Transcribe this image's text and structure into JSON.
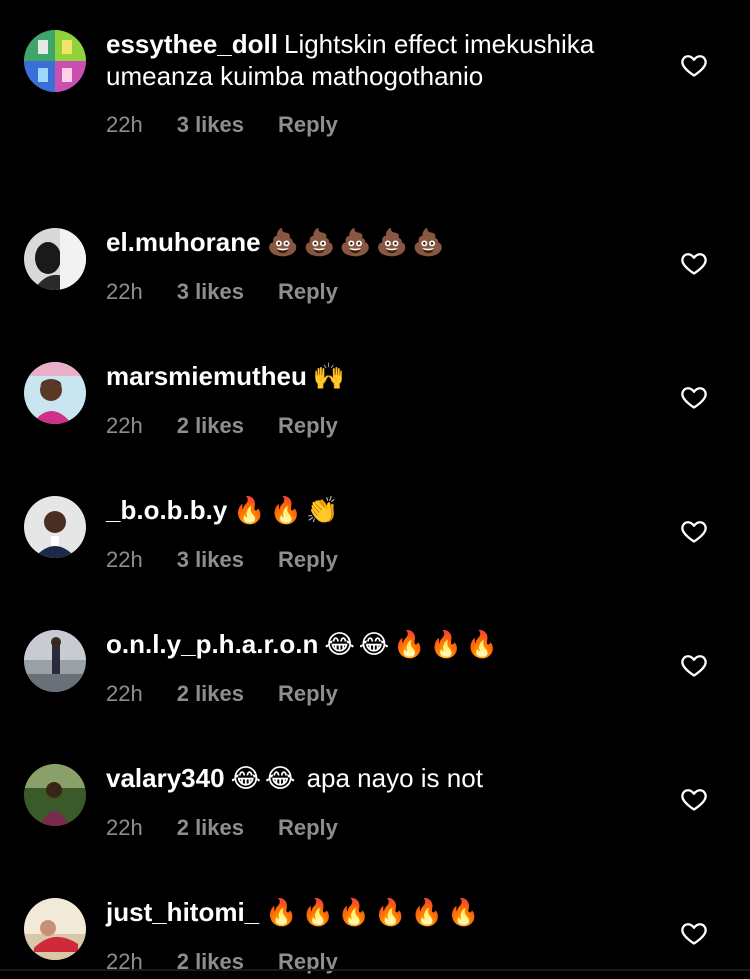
{
  "comments": [
    {
      "username": "essythee_doll",
      "text": "Lightskin effect imekushika umeanza kuimba mathogothanio",
      "emoji": "",
      "text_after": "",
      "time": "22h",
      "likes": "3 likes",
      "reply": "Reply"
    },
    {
      "username": "el.muhorane",
      "text": "",
      "emoji": "💩💩💩💩💩",
      "text_after": "",
      "time": "22h",
      "likes": "3 likes",
      "reply": "Reply"
    },
    {
      "username": "marsmiemutheu",
      "text": "",
      "emoji": "🙌",
      "text_after": "",
      "time": "22h",
      "likes": "2 likes",
      "reply": "Reply"
    },
    {
      "username": "_b.o.b.b.y",
      "text": "",
      "emoji": "🔥🔥👏",
      "text_after": "",
      "time": "22h",
      "likes": "3 likes",
      "reply": "Reply"
    },
    {
      "username": "o.n.l.y_p.h.a.r.o.n",
      "text": "",
      "emoji": "😂😂🔥🔥🔥",
      "text_after": "",
      "time": "22h",
      "likes": "2 likes",
      "reply": "Reply"
    },
    {
      "username": "valary340",
      "text": "",
      "emoji": "😂😂",
      "text_after": "apa nayo is not",
      "time": "22h",
      "likes": "2 likes",
      "reply": "Reply"
    },
    {
      "username": "just_hitomi_",
      "text": "",
      "emoji": "🔥🔥🔥🔥🔥🔥",
      "text_after": "",
      "time": "22h",
      "likes": "2 likes",
      "reply": "Reply"
    }
  ],
  "icons": {
    "like": "heart-outline-icon"
  },
  "colors": {
    "background": "#000000",
    "text": "#ffffff",
    "meta": "#8e8e8e"
  }
}
